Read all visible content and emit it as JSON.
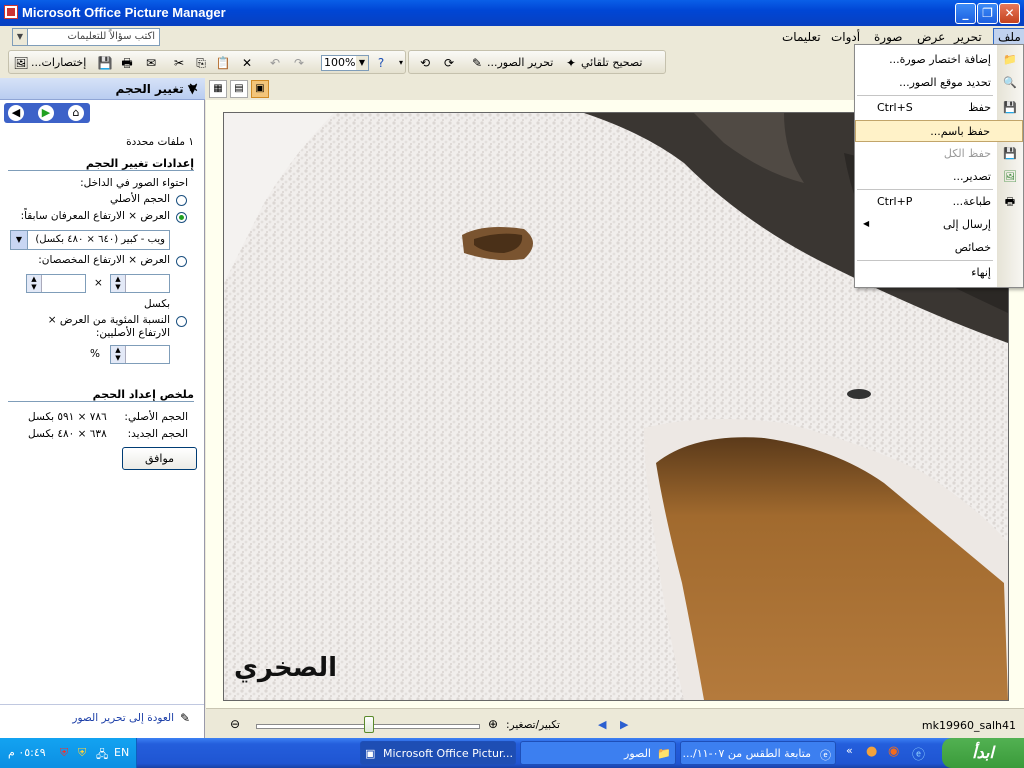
{
  "window": {
    "title": "Microsoft Office Picture Manager"
  },
  "menu": {
    "items": [
      "ملف",
      "تحرير",
      "عرض",
      "صورة",
      "أدوات",
      "تعليمات"
    ],
    "ask_placeholder": "اكتب سؤالاً للتعليمات"
  },
  "toolbar": {
    "shortcuts_label": "إختصارات...",
    "zoom_value": "100%",
    "edit_pictures_label": "تحرير الصور...",
    "autocorrect_label": "تصحيح تلقائي"
  },
  "taskpane": {
    "title": "تغيير الحجم",
    "files_selected": "١ ملفات محددة",
    "settings_header": "إعدادات تغيير الحجم",
    "contain_label": "احتواء الصور في الداخل:",
    "original_size": "الحجم الأصلي",
    "predefined_wh": "العرض × الارتفاع المعرفان سابقاً:",
    "size_option": "ويب - كبير (٦٤٠ × ٤٨٠ بكسل)",
    "custom_wh": "العرض × الارتفاع المخصصان:",
    "times_symbol": "×",
    "pixels": "بكسل",
    "percent_label": "النسبة المئوية من العرض × الارتفاع الأصليين:",
    "percent_symbol": "%",
    "summary_header": "ملخص إعداد الحجم",
    "original_label": "الحجم الأصلي:",
    "original_value": "٧٨٦ × ٥٩١ بكسل",
    "new_label": "الحجم الجديد:",
    "new_value": "٦٣٨ × ٤٨٠ بكسل",
    "ok_label": "موافق",
    "back_link": "العودة إلى تحرير الصور"
  },
  "image": {
    "watermark": "الصخري"
  },
  "zoombar": {
    "label": "تكبير/تصغير:",
    "filename": "mk19960_salh41"
  },
  "file_menu": {
    "items": [
      {
        "label": "إضافة اختصار صورة...",
        "shortcut": "",
        "icon": "folder-add-icon",
        "disabled": false
      },
      {
        "label": "تحديد موقع الصور...",
        "shortcut": "",
        "icon": "locate-pictures-icon",
        "disabled": false
      },
      {
        "label": "حفظ",
        "shortcut": "Ctrl+S",
        "icon": "save-icon",
        "disabled": false
      },
      {
        "label": "حفظ باسم...",
        "shortcut": "",
        "icon": "",
        "disabled": false
      },
      {
        "label": "حفظ الكل",
        "shortcut": "",
        "icon": "save-all-icon",
        "disabled": true
      },
      {
        "label": "تصدير...",
        "shortcut": "",
        "icon": "export-icon",
        "disabled": false
      },
      {
        "label": "طباعة...",
        "shortcut": "Ctrl+P",
        "icon": "print-icon",
        "disabled": false
      },
      {
        "label": "إرسال إلى",
        "shortcut": "",
        "icon": "",
        "disabled": false
      },
      {
        "label": "خصائص",
        "shortcut": "",
        "icon": "",
        "disabled": false
      },
      {
        "label": "إنهاء",
        "shortcut": "",
        "icon": "",
        "disabled": false
      }
    ]
  },
  "taskbar": {
    "start_label": "ابدأ",
    "tasks": [
      "متابعة الطقس من ٠٧-١١/...",
      "الصور",
      "Microsoft Office Pictur..."
    ],
    "clock": "٠٥:٤٩ م",
    "lang": "EN"
  },
  "colors": {
    "accent": "#0A5FE8",
    "menu_highlight": "#FFF2C8",
    "pane_header": "#B9CDF0"
  }
}
